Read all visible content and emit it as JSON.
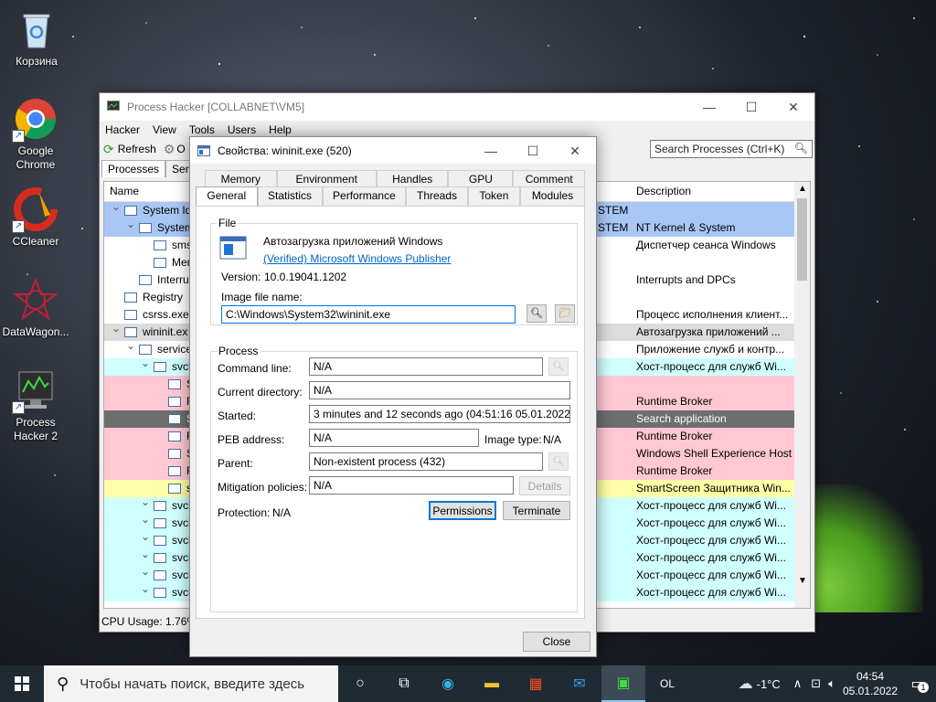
{
  "desktop": {
    "icons": [
      {
        "label": "Корзина",
        "icon": "recycle-bin-icon"
      },
      {
        "label": "Google Chrome",
        "icon": "chrome-icon"
      },
      {
        "label": "CCleaner",
        "icon": "ccleaner-icon"
      },
      {
        "label": "DataWagon...",
        "icon": "datawagon-icon"
      },
      {
        "label": "Process Hacker 2",
        "icon": "process-hacker-icon"
      }
    ]
  },
  "main_window": {
    "title": "Process Hacker [COLLABNET\\VM5]",
    "menu": [
      "Hacker",
      "View",
      "Tools",
      "Users",
      "Help"
    ],
    "toolbar": {
      "refresh_label": "Refresh",
      "options_label": "O",
      "search_placeholder": "Search Processes (Ctrl+K)"
    },
    "tabs": [
      "Processes",
      "Servic"
    ],
    "columns": {
      "name": "Name",
      "description": "Description"
    },
    "rows": [
      {
        "name": "System Idl",
        "desc": "",
        "color": "#a9c7f5",
        "indent": 0,
        "user": "STEM"
      },
      {
        "name": "System",
        "desc": "NT Kernel & System",
        "color": "#a9c7f5",
        "indent": 1,
        "user": "STEM"
      },
      {
        "name": "sms",
        "desc": "Диспетчер сеанса  Windows",
        "color": "#ffffff",
        "indent": 2,
        "user": ""
      },
      {
        "name": "Mer",
        "desc": "",
        "color": "#ffffff",
        "indent": 2,
        "user": ""
      },
      {
        "name": "Interru",
        "desc": "Interrupts and DPCs",
        "color": "#ffffff",
        "indent": 1,
        "user": ""
      },
      {
        "name": "Registry",
        "desc": "",
        "color": "#ffffff",
        "indent": 0,
        "user": ""
      },
      {
        "name": "csrss.exe",
        "desc": "Процесс исполнения клиент...",
        "color": "#ffffff",
        "indent": 0,
        "user": ""
      },
      {
        "name": "wininit.ex",
        "desc": "Автозагрузка приложений ...",
        "color": "#dcdcdc",
        "indent": 0,
        "user": ""
      },
      {
        "name": "service",
        "desc": "Приложение служб и контр...",
        "color": "#ffffff",
        "indent": 1,
        "user": ""
      },
      {
        "name": "svch",
        "desc": "Хост-процесс для служб Wi...",
        "color": "#d0ffff",
        "indent": 2,
        "user": ""
      },
      {
        "name": "S",
        "desc": "",
        "color": "#ffc8d2",
        "indent": 3,
        "user": ""
      },
      {
        "name": "R",
        "desc": "Runtime Broker",
        "color": "#ffc8d2",
        "indent": 3,
        "user": ""
      },
      {
        "name": "S",
        "desc": "Search application",
        "color": "#6e6e6e",
        "indent": 3,
        "user": ""
      },
      {
        "name": "R",
        "desc": "Runtime Broker",
        "color": "#ffc8d2",
        "indent": 3,
        "user": ""
      },
      {
        "name": "S",
        "desc": "Windows Shell Experience Host",
        "color": "#ffc8d2",
        "indent": 3,
        "user": ""
      },
      {
        "name": "R",
        "desc": "Runtime Broker",
        "color": "#ffc8d2",
        "indent": 3,
        "user": ""
      },
      {
        "name": "s",
        "desc": "SmartScreen Защитника Win...",
        "color": "#ffffa8",
        "indent": 3,
        "user": ""
      },
      {
        "name": "svch",
        "desc": "Хост-процесс для служб Wi...",
        "color": "#d0ffff",
        "indent": 2,
        "user": ""
      },
      {
        "name": "svch",
        "desc": "Хост-процесс для служб Wi...",
        "color": "#d0ffff",
        "indent": 2,
        "user": ""
      },
      {
        "name": "svch",
        "desc": "Хост-процесс для служб Wi...",
        "color": "#d0ffff",
        "indent": 2,
        "user": ""
      },
      {
        "name": "svch",
        "desc": "Хост-процесс для служб Wi...",
        "color": "#d0ffff",
        "indent": 2,
        "user": ""
      },
      {
        "name": "svch",
        "desc": "Хост-процесс для служб Wi...",
        "color": "#d0ffff",
        "indent": 2,
        "user": ""
      },
      {
        "name": "svch",
        "desc": "Хост-процесс для служб Wi...",
        "color": "#d0ffff",
        "indent": 2,
        "user": ""
      }
    ],
    "status": "CPU Usage: 1.76%"
  },
  "dialog": {
    "title": "Свойства: wininit.exe (520)",
    "tabs_back": [
      "Memory",
      "Environment",
      "Handles",
      "GPU",
      "Comment"
    ],
    "tabs_front": [
      "General",
      "Statistics",
      "Performance",
      "Threads",
      "Token",
      "Modules"
    ],
    "active_tab": "General",
    "file": {
      "group_title": "File",
      "description": "Автозагрузка приложений Windows",
      "publisher": "(Verified) Microsoft Windows Publisher",
      "version_label": "Version:",
      "version": "10.0.19041.1202",
      "image_label": "Image file name:",
      "image_path": "C:\\Windows\\System32\\wininit.exe"
    },
    "process": {
      "group_title": "Process",
      "command_line_label": "Command line:",
      "command_line": "N/A",
      "current_dir_label": "Current directory:",
      "current_dir": "N/A",
      "started_label": "Started:",
      "started": "3 minutes and 12 seconds ago (04:51:16 05.01.2022)",
      "peb_label": "PEB address:",
      "peb": "N/A",
      "image_type_label": "Image type:",
      "image_type": "N/A",
      "parent_label": "Parent:",
      "parent": "Non-existent process (432)",
      "mitigation_label": "Mitigation policies:",
      "mitigation": "N/A",
      "details_button": "Details",
      "protection_label": "Protection:",
      "protection": "N/A",
      "permissions_button": "Permissions",
      "terminate_button": "Terminate"
    },
    "close_button": "Close"
  },
  "taskbar": {
    "search_placeholder": "Чтобы начать поиск, введите здесь",
    "apps": [
      "task-view-icon",
      "edge-icon",
      "file-explorer-icon",
      "store-icon",
      "mail-icon",
      "process-hacker-icon"
    ],
    "lang": "OL",
    "weather": "-1°C",
    "time": "04:54",
    "date": "05.01.2022",
    "notifications": "1"
  },
  "colors": {
    "accent": "#0078d7",
    "taskbar": "#1f2a33"
  }
}
